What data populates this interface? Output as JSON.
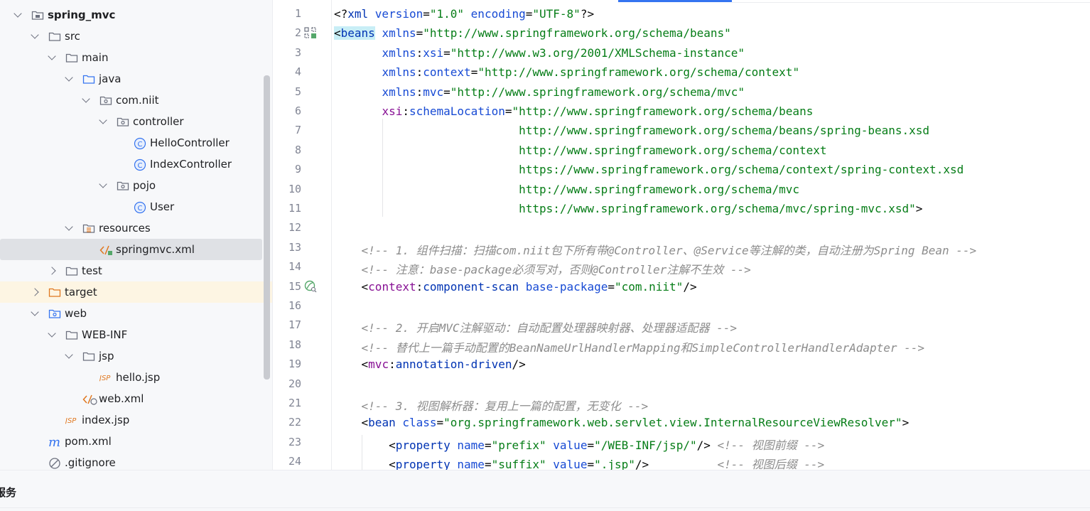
{
  "project_tree": {
    "items": [
      {
        "label": "spring_mvc",
        "type": "module",
        "depth": 0,
        "expanded": true,
        "bold": true
      },
      {
        "label": "src",
        "type": "folder",
        "depth": 1,
        "expanded": true
      },
      {
        "label": "main",
        "type": "folder",
        "depth": 2,
        "expanded": true
      },
      {
        "label": "java",
        "type": "source-folder",
        "depth": 3,
        "expanded": true
      },
      {
        "label": "com.niit",
        "type": "package",
        "depth": 4,
        "expanded": true
      },
      {
        "label": "controller",
        "type": "package",
        "depth": 5,
        "expanded": true
      },
      {
        "label": "HelloController",
        "type": "class",
        "depth": 6
      },
      {
        "label": "IndexController",
        "type": "class",
        "depth": 6
      },
      {
        "label": "pojo",
        "type": "package",
        "depth": 5,
        "expanded": true
      },
      {
        "label": "User",
        "type": "class",
        "depth": 6
      },
      {
        "label": "resources",
        "type": "resources-folder",
        "depth": 3,
        "expanded": true
      },
      {
        "label": "springmvc.xml",
        "type": "xml",
        "depth": 4,
        "selected": true
      },
      {
        "label": "test",
        "type": "folder",
        "depth": 2,
        "expanded": false
      },
      {
        "label": "target",
        "type": "excluded-folder",
        "depth": 1,
        "expanded": false
      },
      {
        "label": "web",
        "type": "web-folder",
        "depth": 1,
        "expanded": true
      },
      {
        "label": "WEB-INF",
        "type": "folder",
        "depth": 2,
        "expanded": true
      },
      {
        "label": "jsp",
        "type": "folder",
        "depth": 3,
        "expanded": true
      },
      {
        "label": "hello.jsp",
        "type": "jsp",
        "depth": 4
      },
      {
        "label": "web.xml",
        "type": "web-xml",
        "depth": 3
      },
      {
        "label": "index.jsp",
        "type": "jsp",
        "depth": 2
      },
      {
        "label": "pom.xml",
        "type": "maven",
        "depth": 1
      },
      {
        "label": ".gitignore",
        "type": "ignore",
        "depth": 1
      }
    ]
  },
  "editor": {
    "lines": [
      {
        "n": "1",
        "tokens": [
          [
            "pun",
            "<?"
          ],
          [
            "tag",
            "xml "
          ],
          [
            "attr",
            "version"
          ],
          [
            "pun",
            "="
          ],
          [
            "str",
            "\"1.0\" "
          ],
          [
            "attr",
            "encoding"
          ],
          [
            "pun",
            "="
          ],
          [
            "str",
            "\"UTF-8\""
          ],
          [
            "pun",
            "?>"
          ]
        ]
      },
      {
        "n": "2",
        "icon": "spring-bean",
        "tokens": [
          [
            "hl",
            "<"
          ],
          [
            "hltag",
            "beans"
          ],
          [
            "pun",
            " "
          ],
          [
            "attr",
            "xmlns"
          ],
          [
            "pun",
            "="
          ],
          [
            "str",
            "\"http://www.springframework.org/schema/beans\""
          ]
        ]
      },
      {
        "n": "3",
        "tokens": [
          [
            "pun",
            "       "
          ],
          [
            "attr",
            "xmlns"
          ],
          [
            "pun",
            ":"
          ],
          [
            "attr",
            "xsi"
          ],
          [
            "pun",
            "="
          ],
          [
            "str",
            "\"http://www.w3.org/2001/XMLSchema-instance\""
          ]
        ]
      },
      {
        "n": "4",
        "tokens": [
          [
            "pun",
            "       "
          ],
          [
            "attr",
            "xmlns"
          ],
          [
            "pun",
            ":"
          ],
          [
            "attr",
            "context"
          ],
          [
            "pun",
            "="
          ],
          [
            "str",
            "\"http://www.springframework.org/schema/context\""
          ]
        ]
      },
      {
        "n": "5",
        "tokens": [
          [
            "pun",
            "       "
          ],
          [
            "attr",
            "xmlns"
          ],
          [
            "pun",
            ":"
          ],
          [
            "attr",
            "mvc"
          ],
          [
            "pun",
            "="
          ],
          [
            "str",
            "\"http://www.springframework.org/schema/mvc\""
          ]
        ]
      },
      {
        "n": "6",
        "tokens": [
          [
            "pun",
            "       "
          ],
          [
            "ns",
            "xsi"
          ],
          [
            "pun",
            ":"
          ],
          [
            "attr",
            "schemaLocation"
          ],
          [
            "pun",
            "="
          ],
          [
            "str",
            "\"http://www.springframework.org/schema/beans"
          ]
        ]
      },
      {
        "n": "7",
        "tokens": [
          [
            "str",
            "                           http://www.springframework.org/schema/beans/spring-beans.xsd"
          ]
        ]
      },
      {
        "n": "8",
        "tokens": [
          [
            "str",
            "                           http://www.springframework.org/schema/context"
          ]
        ]
      },
      {
        "n": "9",
        "tokens": [
          [
            "str",
            "                           https://www.springframework.org/schema/context/spring-context.xsd"
          ]
        ]
      },
      {
        "n": "10",
        "tokens": [
          [
            "str",
            "                           http://www.springframework.org/schema/mvc"
          ]
        ]
      },
      {
        "n": "11",
        "tokens": [
          [
            "str",
            "                           https://www.springframework.org/schema/mvc/spring-mvc.xsd\""
          ],
          [
            "pun",
            ">"
          ]
        ]
      },
      {
        "n": "12",
        "tokens": []
      },
      {
        "n": "13",
        "tokens": [
          [
            "pun",
            "    "
          ],
          [
            "cmt",
            "<!-- 1. 组件扫描：扫描com.niit包下所有带@Controller、@Service等注解的类，自动注册为Spring Bean -->"
          ]
        ]
      },
      {
        "n": "14",
        "tokens": [
          [
            "pun",
            "    "
          ],
          [
            "cmt",
            "<!-- 注意：base-package必须写对，否则@Controller注解不生效 -->"
          ]
        ]
      },
      {
        "n": "15",
        "icon": "component-scan",
        "tokens": [
          [
            "pun",
            "    <"
          ],
          [
            "ns",
            "context"
          ],
          [
            "pun",
            ":"
          ],
          [
            "tag",
            "component-scan "
          ],
          [
            "attr",
            "base-package"
          ],
          [
            "pun",
            "="
          ],
          [
            "str",
            "\"com.niit\""
          ],
          [
            "pun",
            "/>"
          ]
        ]
      },
      {
        "n": "16",
        "tokens": []
      },
      {
        "n": "17",
        "tokens": [
          [
            "pun",
            "    "
          ],
          [
            "cmt",
            "<!-- 2. 开启MVC注解驱动：自动配置处理器映射器、处理器适配器 -->"
          ]
        ]
      },
      {
        "n": "18",
        "tokens": [
          [
            "pun",
            "    "
          ],
          [
            "cmt",
            "<!-- 替代上一篇手动配置的BeanNameUrlHandlerMapping和SimpleControllerHandlerAdapter -->"
          ]
        ]
      },
      {
        "n": "19",
        "tokens": [
          [
            "pun",
            "    <"
          ],
          [
            "ns",
            "mvc"
          ],
          [
            "pun",
            ":"
          ],
          [
            "tag",
            "annotation-driven"
          ],
          [
            "pun",
            "/>"
          ]
        ]
      },
      {
        "n": "20",
        "tokens": []
      },
      {
        "n": "21",
        "tokens": [
          [
            "pun",
            "    "
          ],
          [
            "cmt",
            "<!-- 3. 视图解析器：复用上一篇的配置，无变化 -->"
          ]
        ]
      },
      {
        "n": "22",
        "tokens": [
          [
            "pun",
            "    <"
          ],
          [
            "tag",
            "bean "
          ],
          [
            "attr",
            "class"
          ],
          [
            "pun",
            "="
          ],
          [
            "str",
            "\"org.springframework.web.servlet.view.InternalResourceViewResolver\""
          ],
          [
            "pun",
            ">"
          ]
        ]
      },
      {
        "n": "23",
        "tokens": [
          [
            "pun",
            "        <"
          ],
          [
            "tag",
            "property "
          ],
          [
            "attr",
            "name"
          ],
          [
            "pun",
            "="
          ],
          [
            "str",
            "\"prefix\" "
          ],
          [
            "attr",
            "value"
          ],
          [
            "pun",
            "="
          ],
          [
            "str",
            "\"/WEB-INF/jsp/\""
          ],
          [
            "pun",
            "/> "
          ],
          [
            "cmt",
            "<!-- 视图前缀 -->"
          ]
        ]
      },
      {
        "n": "24",
        "tokens": [
          [
            "pun",
            "        <"
          ],
          [
            "tag",
            "property "
          ],
          [
            "attr",
            "name"
          ],
          [
            "pun",
            "="
          ],
          [
            "str",
            "\"suffix\" "
          ],
          [
            "attr",
            "value"
          ],
          [
            "pun",
            "="
          ],
          [
            "str",
            "\".jsp\""
          ],
          [
            "pun",
            "/>          "
          ],
          [
            "cmt",
            "<!-- 视图后缀 -->"
          ]
        ]
      }
    ]
  },
  "bottom_panel": {
    "title": "服务"
  },
  "colors": {
    "accent": "#3574f0",
    "selection": "#dfe1e5",
    "excluded": "#fdf5e3",
    "folder_icon": "#6c707e",
    "class_icon": "#3574f0",
    "jsp_icon": "#e0771e"
  }
}
